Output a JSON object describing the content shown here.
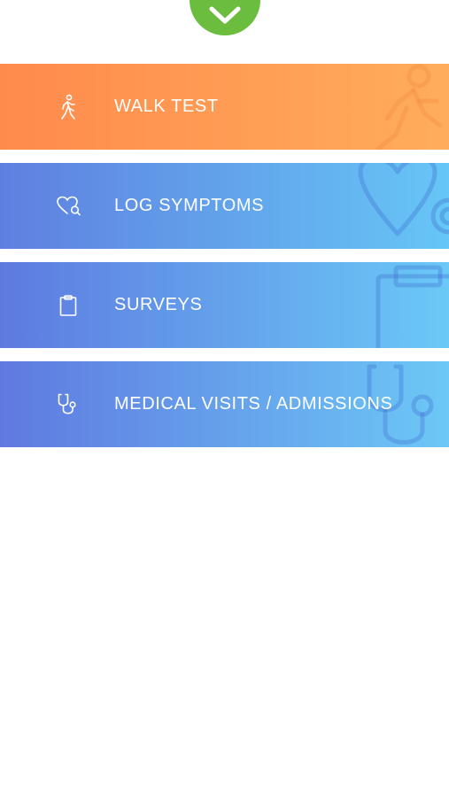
{
  "header": {
    "collapse_icon": "chevron-down-icon",
    "accent": "#6bbd3e"
  },
  "menu": {
    "items": [
      {
        "label": "WALK TEST",
        "icon": "walking-person-icon",
        "colors": [
          "#ff8a4c",
          "#ffad5c"
        ]
      },
      {
        "label": "LOG SYMPTOMS",
        "icon": "heart-search-icon",
        "colors": [
          "#5f7fe0",
          "#66c6f6"
        ]
      },
      {
        "label": "SURVEYS",
        "icon": "clipboard-icon",
        "colors": [
          "#5e7ae0",
          "#6ac9f7"
        ]
      },
      {
        "label": "MEDICAL VISITS / ADMISSIONS",
        "icon": "stethoscope-icon",
        "colors": [
          "#5f79e0",
          "#6cc8f6"
        ]
      }
    ]
  }
}
